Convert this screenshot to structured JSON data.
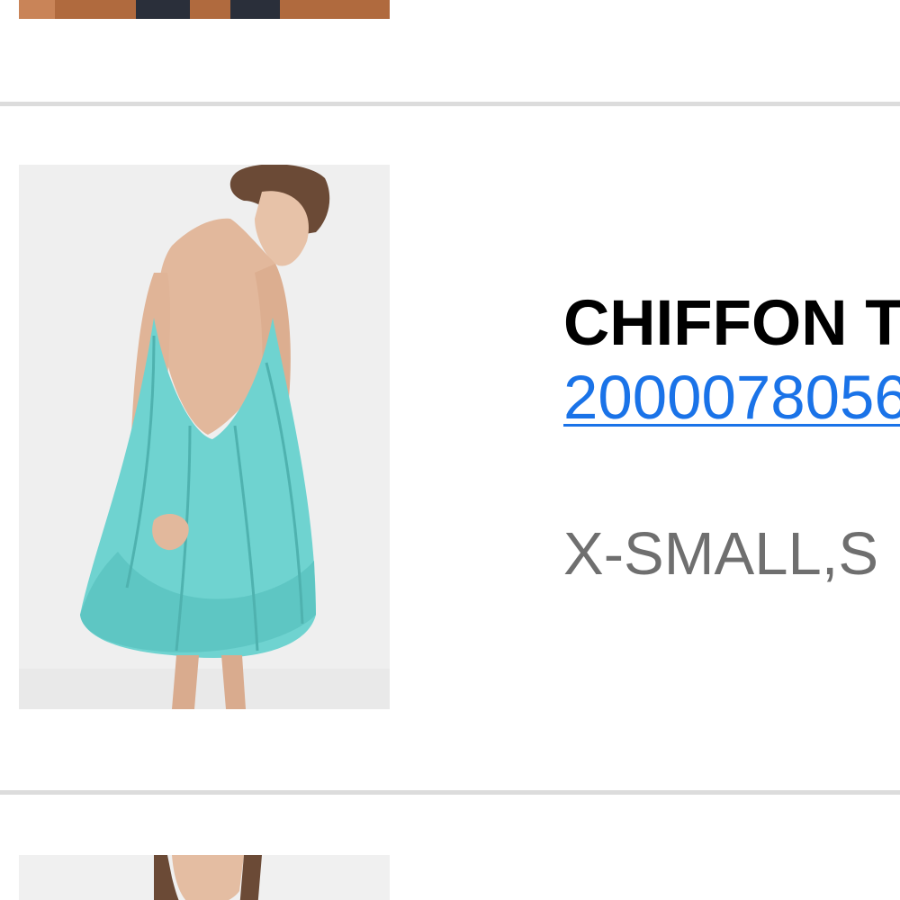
{
  "colors": {
    "divider": "#dcdcdc",
    "link": "#1a73e8",
    "name": "#000000",
    "sizes": "#6f6f6f",
    "dress": "#6fd3d0"
  },
  "products": [
    {
      "image_icon": "product-photo-partial"
    },
    {
      "name": "CHIFFON T",
      "id_link": "2000078056",
      "sizes": "X-SMALL,S",
      "image_icon": "product-photo-teal-dress"
    },
    {
      "image_icon": "product-photo-partial"
    }
  ]
}
